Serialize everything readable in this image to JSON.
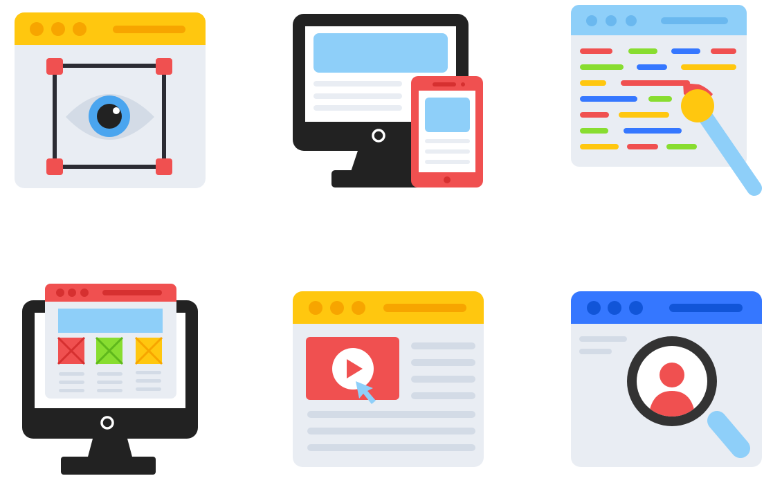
{
  "icons": [
    {
      "name": "visual-design-icon"
    },
    {
      "name": "responsive-design-icon"
    },
    {
      "name": "code-editing-icon"
    },
    {
      "name": "wireframe-layout-icon"
    },
    {
      "name": "video-content-icon"
    },
    {
      "name": "user-search-icon"
    }
  ],
  "colors": {
    "yellow": "#ffc70f",
    "yellow_dark": "#f7a500",
    "blue_light": "#8ecff9",
    "blue": "#3577ff",
    "blue_dark": "#1155d8",
    "red": "#f05050",
    "red_dark": "#d63030",
    "green": "#88dd30",
    "black": "#222222",
    "panel": "#e9edf3",
    "line": "#d3dbe6",
    "white": "#ffffff"
  }
}
